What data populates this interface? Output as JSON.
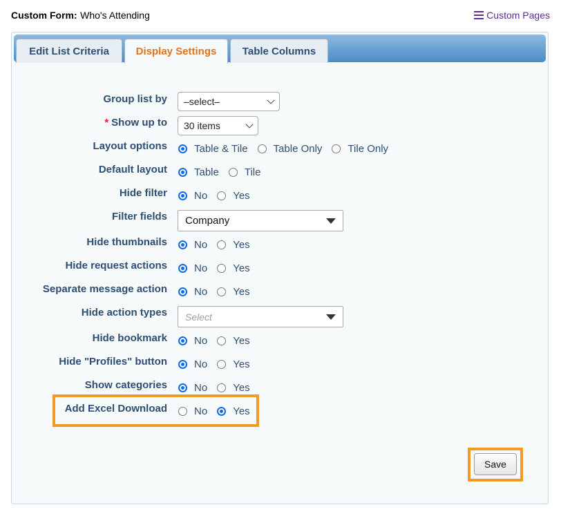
{
  "header": {
    "form_label": "Custom Form:",
    "form_name": "Who's Attending",
    "custom_pages_link": "Custom Pages"
  },
  "tabs": [
    {
      "label": "Edit List Criteria",
      "active": false
    },
    {
      "label": "Display Settings",
      "active": true
    },
    {
      "label": "Table Columns",
      "active": false
    }
  ],
  "form": {
    "group_list_by": {
      "label": "Group list by",
      "value": "–select–"
    },
    "show_up_to": {
      "required_mark": "*",
      "label": "Show up to",
      "value": "30 items"
    },
    "layout_options": {
      "label": "Layout options",
      "options": [
        "Table & Tile",
        "Table Only",
        "Tile Only"
      ],
      "selected": "Table & Tile"
    },
    "default_layout": {
      "label": "Default layout",
      "options": [
        "Table",
        "Tile"
      ],
      "selected": "Table"
    },
    "hide_filter": {
      "label": "Hide filter",
      "options": [
        "No",
        "Yes"
      ],
      "selected": "No"
    },
    "filter_fields": {
      "label": "Filter fields",
      "value": "Company"
    },
    "hide_thumbnails": {
      "label": "Hide thumbnails",
      "options": [
        "No",
        "Yes"
      ],
      "selected": "No"
    },
    "hide_request_actions": {
      "label": "Hide request actions",
      "options": [
        "No",
        "Yes"
      ],
      "selected": "No"
    },
    "separate_message_action": {
      "label": "Separate message action",
      "options": [
        "No",
        "Yes"
      ],
      "selected": "No"
    },
    "hide_action_types": {
      "label": "Hide action types",
      "placeholder": "Select"
    },
    "hide_bookmark": {
      "label": "Hide bookmark",
      "options": [
        "No",
        "Yes"
      ],
      "selected": "No"
    },
    "hide_profiles_button": {
      "label": "Hide \"Profiles\" button",
      "options": [
        "No",
        "Yes"
      ],
      "selected": "No"
    },
    "show_categories": {
      "label": "Show categories",
      "options": [
        "No",
        "Yes"
      ],
      "selected": "No"
    },
    "add_excel_download": {
      "label": "Add Excel Download",
      "options": [
        "No",
        "Yes"
      ],
      "selected": "Yes"
    }
  },
  "save_button": "Save",
  "colors": {
    "highlight": "#f39a24",
    "active_tab": "#e2731e",
    "label": "#2d4e72",
    "radio_on": "#0f6be8"
  }
}
